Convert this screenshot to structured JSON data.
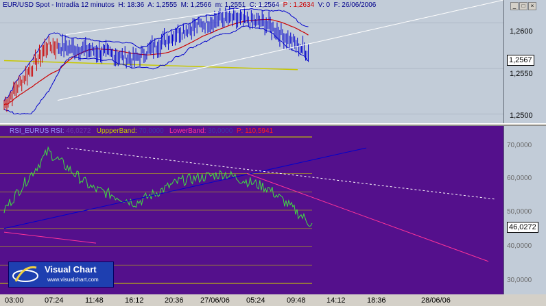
{
  "header": {
    "symbol": "EUR/USD Spot",
    "interval": "Intradía 12 minutos",
    "h_label": "H:",
    "h_value": "18:36",
    "a_label": "A:",
    "a_value": "1,2555",
    "m_label": "M:",
    "m_value": "1,2566",
    "mi_label": "m:",
    "mi_value": "1,2551",
    "c_label": "C:",
    "c_value": "1,2564",
    "p_label": "P :",
    "p_value": "1,2634",
    "v_label": "V: 0",
    "f_label": "F: 26/06/2006"
  },
  "window_controls": {
    "minimize": "_",
    "restore": "□",
    "close": "×"
  },
  "rsi_header": {
    "name": "RSI_EURUS",
    "rsi_label": "RSI:",
    "rsi_value": "46,0272",
    "upper_label": "UppperBand:",
    "upper_value": "70,0000",
    "lower_label": "LowerBand:",
    "lower_value": "30,0000",
    "p_label": "P:",
    "p_value": "110,5941"
  },
  "price_axis": {
    "ticks": [
      "1,2600",
      "1,2550",
      "1,2500"
    ],
    "last": "1,2567"
  },
  "rsi_axis": {
    "ticks": [
      "70,0000",
      "60,0000",
      "50,0000",
      "40,0000",
      "30,0000"
    ],
    "last": "46,0272"
  },
  "time_axis": [
    "03:00",
    "07:24",
    "11:48",
    "16:12",
    "20:36",
    "27/06/06",
    "05:24",
    "09:48",
    "14:12",
    "18:36",
    "28/06/06"
  ],
  "logo": {
    "brand": "Visual Chart",
    "url": "www.visualchart.com"
  },
  "colors": {
    "price_bg": "#C2CCD8",
    "rsi_bg": "#54108C",
    "bars": "#0000CC",
    "bars_early": "#CC0000",
    "bollinger": "#0000CC",
    "ma_red": "#CC0000",
    "ma_yellow": "#C8C800",
    "trendline": "#ffffff",
    "rsi_line": "#40E040",
    "rsi_band": "#C8C800",
    "rsi_trend": "#FF3399"
  },
  "chart_data": [
    {
      "type": "line",
      "title": "EUR/USD Spot - Intradía 12 minutos",
      "ylim": [
        1.249,
        1.2625
      ],
      "yticks": [
        1.25,
        1.255,
        1.26
      ],
      "x": [
        "03:00",
        "07:24",
        "11:48",
        "16:12",
        "20:36",
        "27/06/06",
        "05:24",
        "09:48"
      ],
      "series": [
        {
          "name": "EUR/USD Spot",
          "values": [
            1.251,
            1.2575,
            1.257,
            1.256,
            1.259,
            1.2605,
            1.26,
            1.2567
          ]
        }
      ],
      "last": 1.2567
    },
    {
      "type": "line",
      "title": "RSI_EURUS",
      "ylim": [
        27,
        73
      ],
      "yticks": [
        30,
        40,
        50,
        60,
        70
      ],
      "x": [
        "03:00",
        "07:24",
        "11:48",
        "16:12",
        "20:36",
        "27/06/06",
        "05:24",
        "09:48"
      ],
      "series": [
        {
          "name": "RSI",
          "values": [
            50,
            66,
            56,
            52,
            58,
            60,
            56,
            46.0272
          ]
        }
      ],
      "bands": {
        "UppperBand": 70,
        "LowerBand": 30
      },
      "last": 46.0272
    }
  ]
}
